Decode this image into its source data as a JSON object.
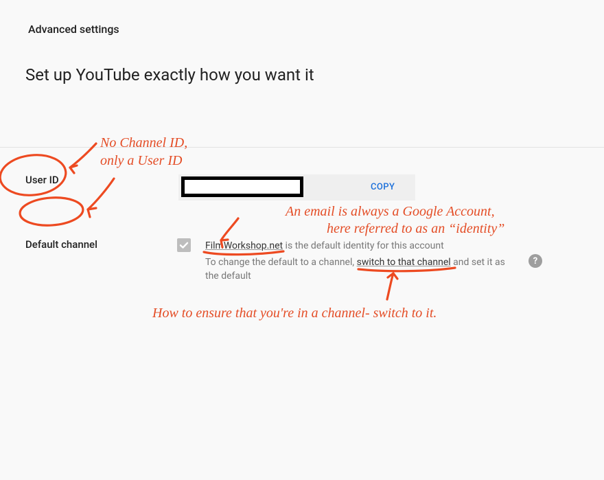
{
  "header": {
    "title": "Advanced settings",
    "subtitle": "Set up YouTube exactly how you want it"
  },
  "userIdRow": {
    "label": "User ID",
    "value": "",
    "copy_label": "COPY"
  },
  "defaultChannel": {
    "label": "Default channel",
    "checked": true,
    "identity_link": "FilmWorkshop.net",
    "line1_tail": " is the default identity for this account",
    "line2_pre": "To change the default to a channel, ",
    "line2_link": "switch to that channel",
    "line2_post": " and set it as the default",
    "help_char": "?"
  },
  "annotations": {
    "note1_line1": "No Channel ID,",
    "note1_line2": "only  a User ID",
    "note2_line1": "An email is always a Google Account,",
    "note2_line2": "here referred to as an “identity”",
    "note3": "How to ensure that you're in a channel-  switch to it."
  }
}
